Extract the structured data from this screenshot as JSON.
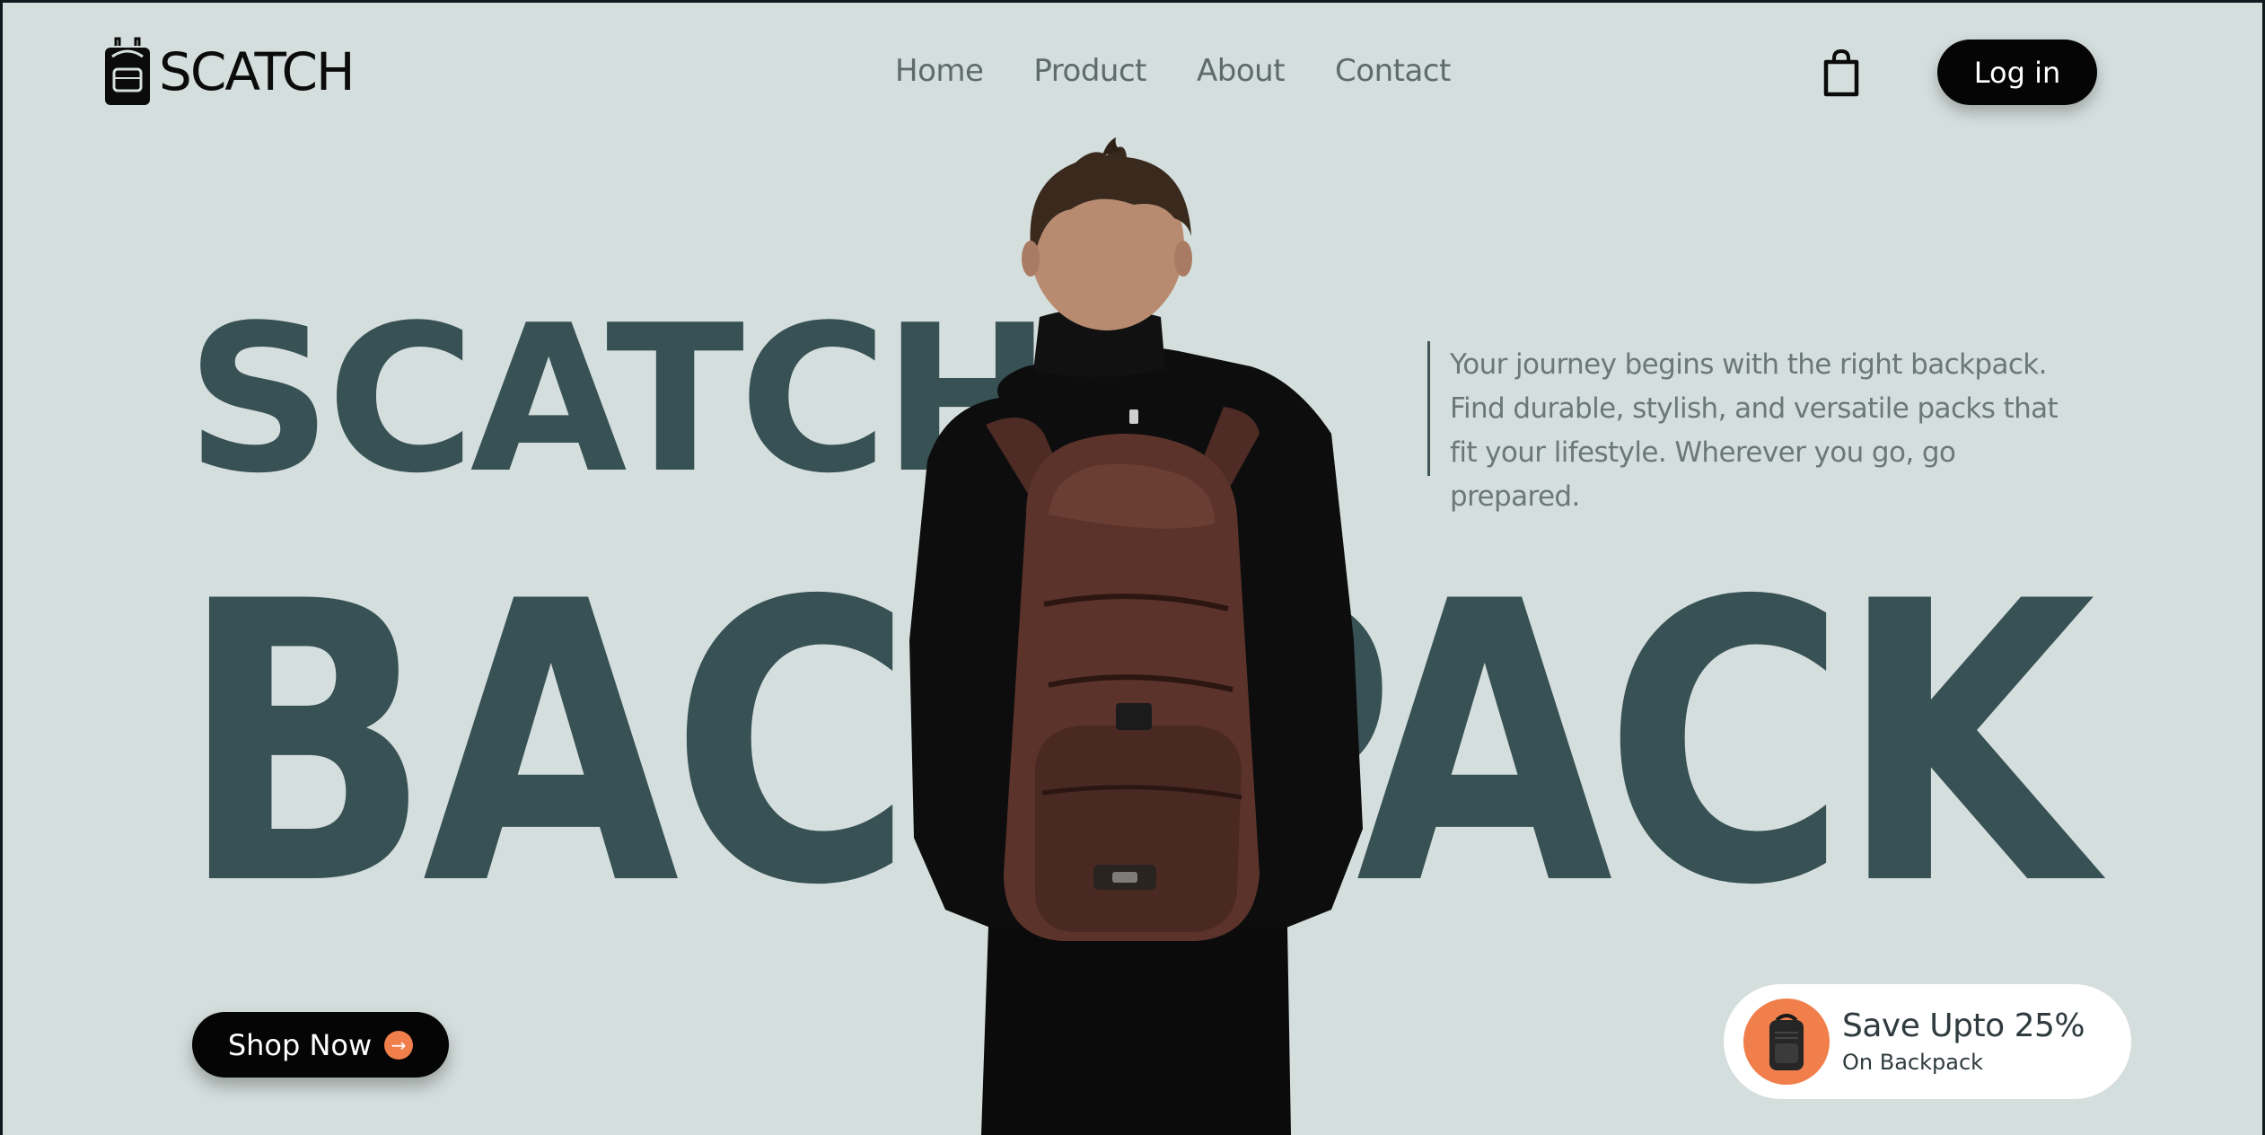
{
  "brand": {
    "name": "SCATCH",
    "logo_icon": "backpack-icon"
  },
  "nav": {
    "items": [
      {
        "label": "Home"
      },
      {
        "label": "Product"
      },
      {
        "label": "About"
      },
      {
        "label": "Contact"
      }
    ]
  },
  "header": {
    "cart_icon": "shopping-bag-icon",
    "login_label": "Log in"
  },
  "hero": {
    "title_small": "SCATCH",
    "title_big": "BACKPACK",
    "description": "Your journey begins with the right backpack. Find durable, stylish, and versatile packs that fit your lifestyle. Wherever you go, go prepared.",
    "cta_label": "Shop Now",
    "cta_icon": "arrow-right-icon"
  },
  "promo": {
    "title": "Save Upto 25%",
    "subtitle": "On Backpack",
    "icon": "backpack-icon"
  },
  "colors": {
    "background": "#d4dedc",
    "heading": "#385154",
    "accent": "#f07f4c",
    "button": "#050505"
  }
}
